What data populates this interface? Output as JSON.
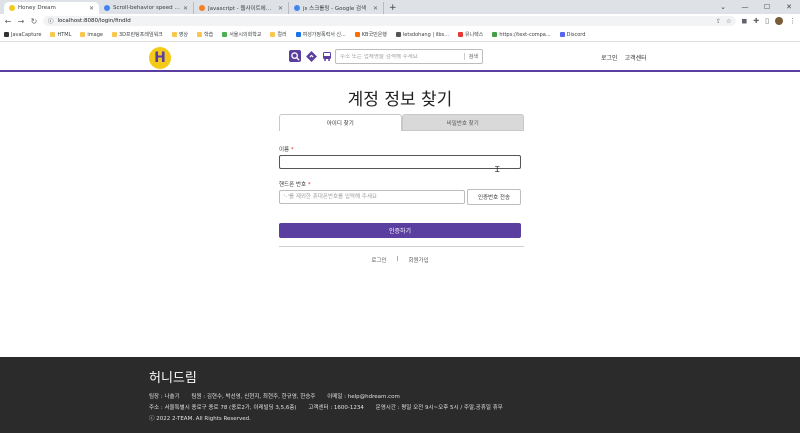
{
  "browser": {
    "tabs": [
      {
        "title": "Honey Dream",
        "active": true,
        "color": "#f4c917"
      },
      {
        "title": "Scroll-behavior speed - Google",
        "active": false,
        "color": "#4285f4"
      },
      {
        "title": "Javascript - 웹사이트에서 스크롤",
        "active": false,
        "color": "#f48024"
      },
      {
        "title": "js 스크롤링 - Google 검색",
        "active": false,
        "color": "#4285f4"
      }
    ],
    "url": "localhost:8080/login/findId",
    "bookmarks": [
      "JavaCapture",
      "HTML",
      "image",
      "3D프린팅프레임워크",
      "영상",
      "학습",
      "서울시의회학교",
      "컬러",
      "여성가정폭력서 신...",
      "KB국민은행",
      "letsdohang | ilbs...",
      "유니렉스",
      "https://text-compa...",
      "Discord"
    ]
  },
  "header": {
    "logo_letter": "H",
    "search_placeholder": "주소 또는 업체명을 검색해 주세요",
    "search_button": "검색",
    "links": [
      "로그인",
      "고객센터"
    ]
  },
  "page": {
    "title": "계정 정보 찾기",
    "tabs": [
      "아이디 찾기",
      "비밀번호 찾기"
    ],
    "name_label": "이름",
    "phone_label": "핸드폰 번호",
    "required_mark": "*",
    "phone_placeholder": "'-'를 제외한 휴대폰번호를 입력해 주세요",
    "send_code_button": "인증번호 전송",
    "verify_button": "인증하기",
    "bottom_links": [
      "로그인",
      "|",
      "회원가입"
    ]
  },
  "footer": {
    "brand": "허니드림",
    "line1": [
      "팀장 : 나솔기",
      "팀원 : 김현수, 박선영, 신현지, 최현주, 한규영, 한승주",
      "이메일 : help@hdream.com"
    ],
    "line2": [
      "주소 : 서울특별시 종로구 종로 78 (종로2가, 이레빌딩 3,5,6층)",
      "고객센터 : 1600-1234",
      "운영시간 : 평일 오전 9시~오후 5시 / 주말,공휴일 휴무"
    ],
    "copyright": "ⓒ 2022 2-TEAM. All Rights Reserved."
  },
  "colors": {
    "accent": "#5b3fa0",
    "logo": "#f4c917",
    "footer_bg": "#2b2b2b"
  }
}
